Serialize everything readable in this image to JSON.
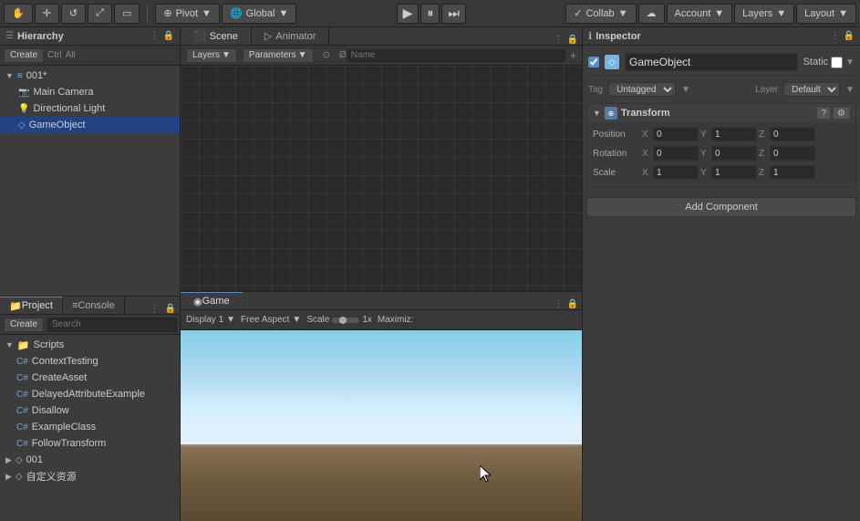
{
  "toolbar": {
    "pivot_label": "Pivot",
    "global_label": "Global",
    "play_icon": "▶",
    "pause_icon": "⏸",
    "step_icon": "⏭",
    "collab_label": "Collab",
    "cloud_icon": "☁",
    "account_label": "Account",
    "layers_label": "Layers",
    "layout_label": "Layout"
  },
  "hierarchy": {
    "panel_title": "Hierarchy",
    "create_label": "Create",
    "all_label": "All",
    "search_placeholder": "Q+All",
    "items": [
      {
        "name": "001*",
        "level": 0,
        "type": "scene",
        "has_arrow": true
      },
      {
        "name": "Main Camera",
        "level": 1,
        "type": "camera"
      },
      {
        "name": "Directional Light",
        "level": 1,
        "type": "light"
      },
      {
        "name": "GameObject",
        "level": 1,
        "type": "gameobj",
        "selected": true
      }
    ]
  },
  "scene": {
    "tab_label": "Scene",
    "animator_tab_label": "Animator",
    "layers_label": "Layers",
    "parameters_label": "Parameters"
  },
  "game": {
    "tab_label": "Game",
    "display_label": "Display 1",
    "aspect_label": "Free Aspect",
    "scale_label": "Scale",
    "scale_value": "1x",
    "maximize_label": "Maximiz:"
  },
  "inspector": {
    "panel_title": "Inspector",
    "lock_icon": "🔒",
    "gameobject_name": "GameObject",
    "static_label": "Static",
    "tag_label": "Tag",
    "tag_value": "Untagged",
    "layer_label": "Layer",
    "layer_value": "Default",
    "transform_title": "Transform",
    "position_label": "Position",
    "rotation_label": "Rotation",
    "scale_label": "Scale",
    "pos_x": "0",
    "pos_y": "1",
    "pos_z": "0",
    "rot_x": "0",
    "rot_y": "0",
    "rot_z": "0",
    "scale_x": "1",
    "scale_y": "1",
    "scale_z": "1",
    "add_component_label": "Add Component"
  },
  "project": {
    "project_tab": "Project",
    "console_tab": "Console",
    "create_label": "Create",
    "search_placeholder": "Search",
    "folders": [
      {
        "name": "Scripts",
        "expanded": true
      },
      {
        "name": "001",
        "expanded": false
      },
      {
        "name": "自定义资源",
        "expanded": false
      }
    ],
    "scripts": [
      "ContextTesting",
      "CreateAsset",
      "DelayedAttributeExample",
      "Disallow",
      "ExampleClass",
      "FollowTransform"
    ]
  }
}
